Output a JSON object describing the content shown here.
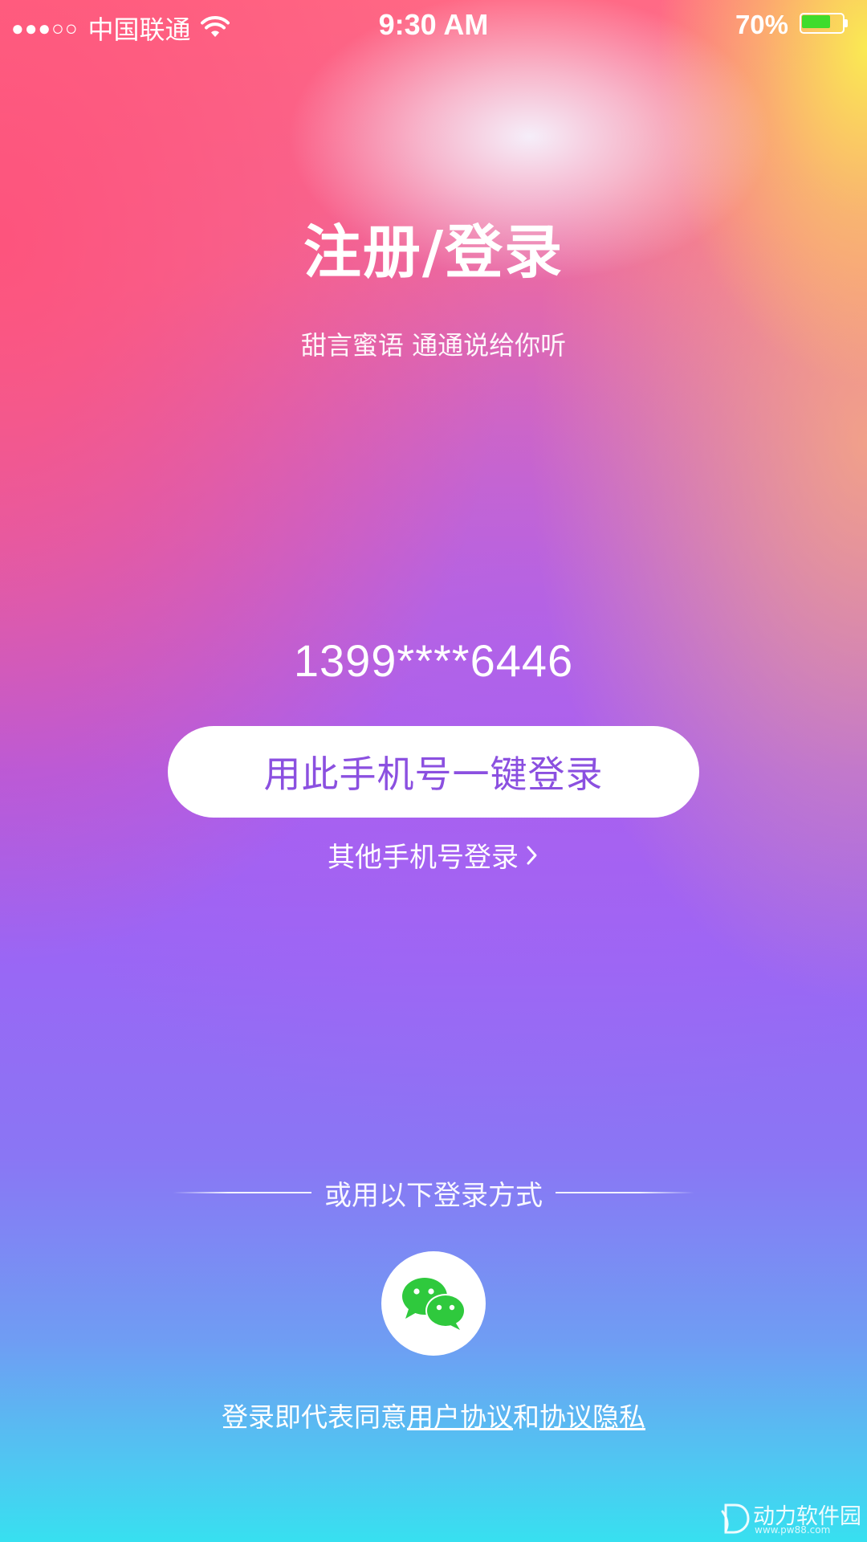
{
  "status_bar": {
    "signal": "●●●○○",
    "carrier": "中国联通",
    "time": "9:30 AM",
    "battery_percent_label": "70%",
    "battery_level": 0.7,
    "battery_color": "#3fdc2c"
  },
  "header": {
    "title": "注册/登录",
    "subtitle": "甜言蜜语 通通说给你听"
  },
  "login": {
    "phone_number": "1399****6446",
    "one_click_button": "用此手机号一键登录",
    "other_phone_link": "其他手机号登录"
  },
  "alt_login": {
    "divider_text": "或用以下登录方式",
    "wechat_icon": "wechat-icon"
  },
  "agreement": {
    "prefix": "登录即代表同意",
    "user_agreement": "用户协议",
    "conjunction": "和",
    "privacy": "协议隐私"
  },
  "watermark": {
    "text": "动力软件园",
    "url": "www.pw88.com"
  },
  "colors": {
    "accent_text": "#8b50e0",
    "wechat_green": "#2fc93d"
  }
}
